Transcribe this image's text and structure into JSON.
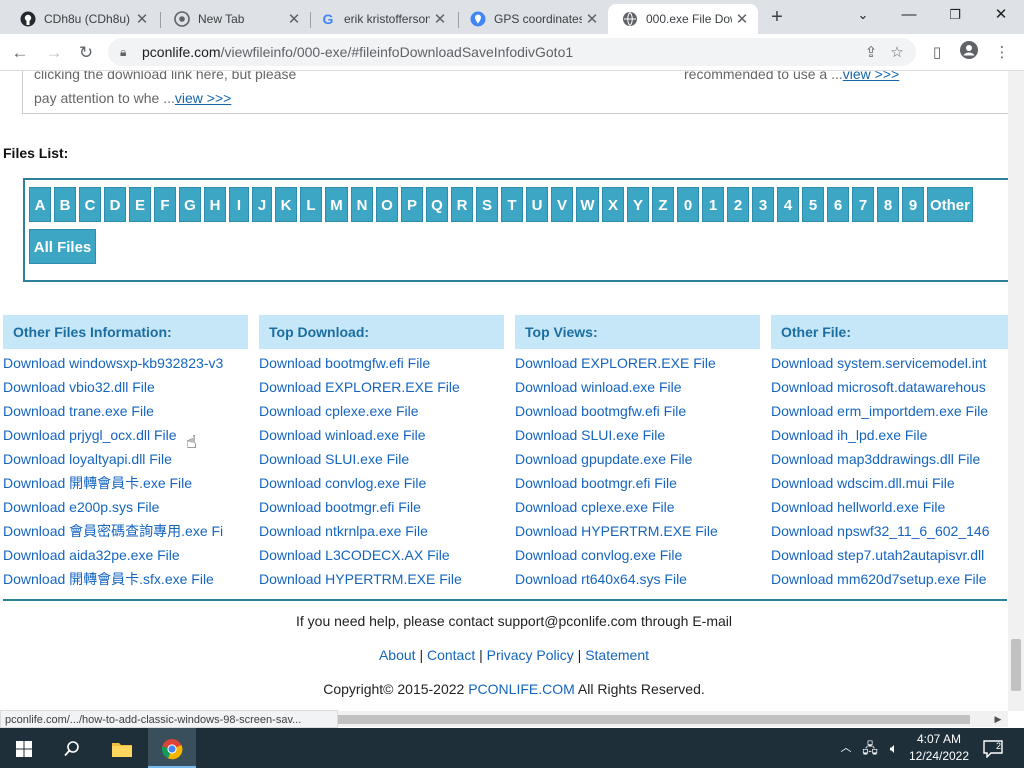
{
  "browser": {
    "tabs": [
      {
        "title": "CDh8u (CDh8u)",
        "icon": "github-icon"
      },
      {
        "title": "New Tab",
        "icon": "chrome-icon"
      },
      {
        "title": "erik kristofferson",
        "icon": "google-icon"
      },
      {
        "title": "GPS coordinates",
        "icon": "map-pin-icon"
      },
      {
        "title": "000.exe File Dow",
        "icon": "globe-icon"
      }
    ],
    "url_host": "pconlife.com",
    "url_path": "/viewfileinfo/000-exe/#fileinfoDownloadSaveInfodivGoto1"
  },
  "snippets": {
    "left_line1": "clicking the download link here, but please",
    "left_line2_text": "pay attention to whe ...",
    "left_line2_link": "view >>>",
    "right_text": "recommended to use a ...",
    "right_link": "view >>>"
  },
  "files_list_label": "Files List:",
  "letters": [
    "A",
    "B",
    "C",
    "D",
    "E",
    "F",
    "G",
    "H",
    "I",
    "J",
    "K",
    "L",
    "M",
    "N",
    "O",
    "P",
    "Q",
    "R",
    "S",
    "T",
    "U",
    "V",
    "W",
    "X",
    "Y",
    "Z",
    "0",
    "1",
    "2",
    "3",
    "4",
    "5",
    "6",
    "7",
    "8",
    "9",
    "Other"
  ],
  "all_files_label": "All Files",
  "columns": [
    {
      "heading": "Other Files Information:",
      "items": [
        "Download windowsxp-kb932823-v3",
        "Download vbio32.dll File",
        "Download trane.exe File",
        "Download prjygl_ocx.dll File",
        "Download loyaltyapi.dll File",
        "Download 開轉會員卡.exe File",
        "Download e200p.sys File",
        "Download 會員密碼查詢專用.exe Fi",
        "Download aida32pe.exe File",
        "Download 開轉會員卡.sfx.exe File"
      ]
    },
    {
      "heading": "Top Download:",
      "items": [
        "Download bootmgfw.efi File",
        "Download EXPLORER.EXE File",
        "Download cplexe.exe File",
        "Download winload.exe File",
        "Download SLUI.exe File",
        "Download convlog.exe File",
        "Download bootmgr.efi File",
        "Download ntkrnlpa.exe File",
        "Download L3CODECX.AX File",
        "Download HYPERTRM.EXE File"
      ]
    },
    {
      "heading": "Top Views:",
      "items": [
        "Download EXPLORER.EXE File",
        "Download winload.exe File",
        "Download bootmgfw.efi File",
        "Download SLUI.exe File",
        "Download gpupdate.exe File",
        "Download bootmgr.efi File",
        "Download cplexe.exe File",
        "Download HYPERTRM.EXE File",
        "Download convlog.exe File",
        "Download rt640x64.sys File"
      ]
    },
    {
      "heading": "Other File:",
      "items": [
        "Download system.servicemodel.int",
        "Download microsoft.datawarehous",
        "Download erm_importdem.exe File",
        "Download ih_lpd.exe File",
        "Download map3ddrawings.dll File",
        "Download wdscim.dll.mui File",
        "Download hellworld.exe File",
        "Download npswf32_11_6_602_146",
        "Download step7.utah2autapisvr.dll",
        "Download mm620d7setup.exe File"
      ]
    }
  ],
  "footer": {
    "contact": "If you need help, please contact support@pconlife.com through E-mail",
    "links": [
      "About",
      "Contact",
      "Privacy Policy",
      "Statement"
    ],
    "separator": "|",
    "copyright_prefix": "Copyright© 2015-2022 ",
    "copyright_link": "PCONLIFE.COM",
    "copyright_suffix": " All Rights Reserved."
  },
  "status_url": "pconlife.com/.../how-to-add-classic-windows-98-screen-sav...",
  "taskbar": {
    "time": "4:07 AM",
    "date": "12/24/2022",
    "notification_count": "2"
  },
  "colors": {
    "accent": "#3ea6c5",
    "heading_bg": "#c5e7f7",
    "link": "#1565c0",
    "border": "#2d7f9c"
  }
}
